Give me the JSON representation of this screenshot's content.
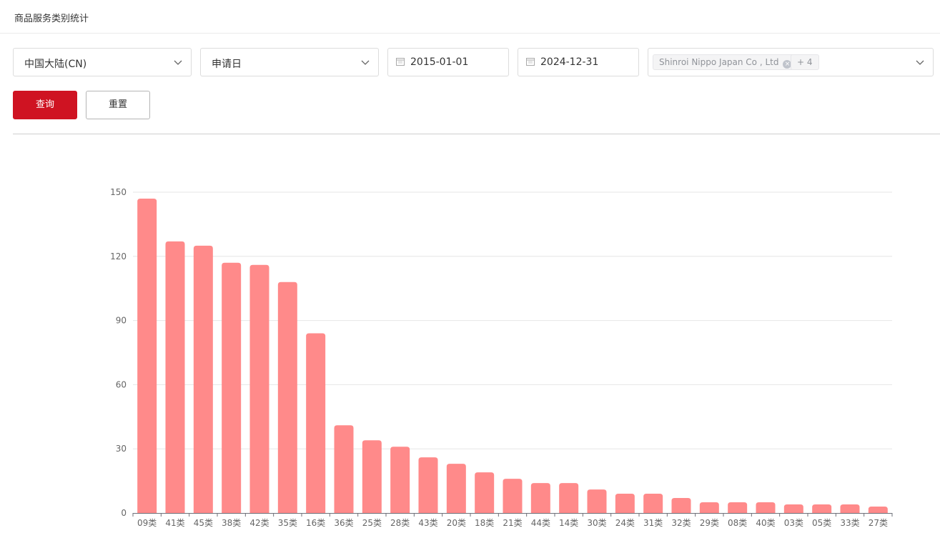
{
  "page": {
    "title": "商品服务类别统计"
  },
  "filters": {
    "region": "中国大陆(CN)",
    "date_type": "申请日",
    "start_date": "2015-01-01",
    "end_date": "2024-12-31",
    "applicant_tag": "Shinroi Nippo Japan Co , Ltd",
    "more_tag": "+ 4"
  },
  "buttons": {
    "query": "查询",
    "reset": "重置"
  },
  "colors": {
    "primary": "#cf1322",
    "bar": "#ff8a8a"
  },
  "chart_data": {
    "type": "bar",
    "categories": [
      "09类",
      "41类",
      "45类",
      "38类",
      "42类",
      "35类",
      "16类",
      "36类",
      "25类",
      "28类",
      "43类",
      "20类",
      "18类",
      "21类",
      "44类",
      "14类",
      "30类",
      "24类",
      "31类",
      "32类",
      "29类",
      "08类",
      "40类",
      "03类",
      "05类",
      "33类",
      "27类"
    ],
    "values": [
      147,
      127,
      125,
      117,
      116,
      108,
      84,
      41,
      34,
      31,
      26,
      23,
      19,
      16,
      14,
      14,
      11,
      9,
      9,
      7,
      5,
      5,
      5,
      4,
      4,
      4,
      3
    ],
    "ylim": [
      0,
      150
    ],
    "yticks": [
      "0",
      "30",
      "60",
      "90",
      "120",
      "150"
    ],
    "grid": true
  }
}
